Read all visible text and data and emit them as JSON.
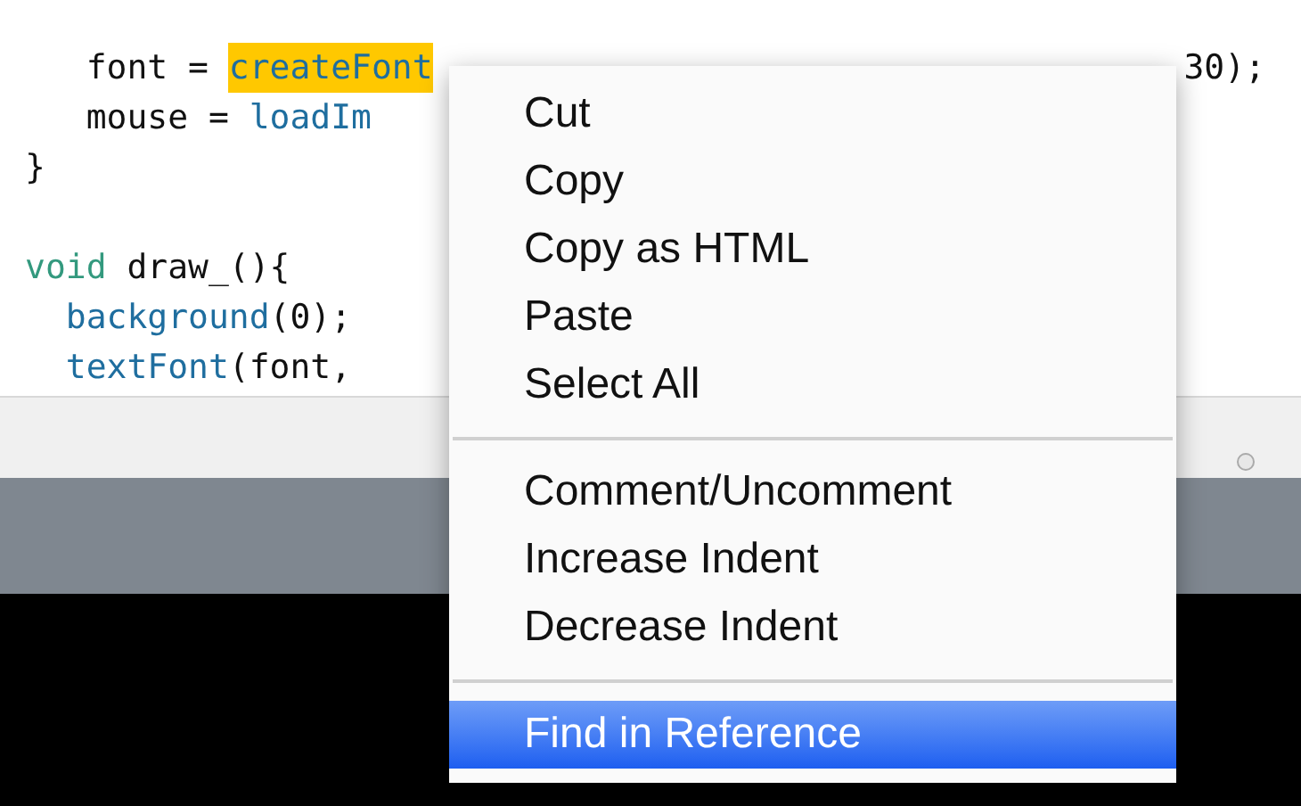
{
  "editor": {
    "lines": [
      {
        "kind": "code",
        "tokens": [
          {
            "kind": "plain",
            "text": "   font = "
          },
          {
            "kind": "selected",
            "text": "createFont"
          }
        ],
        "tail": "30);"
      },
      {
        "kind": "code",
        "tokens": [
          {
            "kind": "plain",
            "text": "   mouse = "
          },
          {
            "kind": "function",
            "text": "loadIm"
          }
        ]
      },
      {
        "kind": "code",
        "tokens": [
          {
            "kind": "plain",
            "text": "}"
          }
        ]
      },
      {
        "kind": "blank"
      },
      {
        "kind": "code",
        "tokens": [
          {
            "kind": "keyword",
            "text": "void"
          },
          {
            "kind": "plain",
            "text": " draw_(){"
          }
        ]
      },
      {
        "kind": "code",
        "tokens": [
          {
            "kind": "function",
            "text": "  background"
          },
          {
            "kind": "plain",
            "text": "(0);"
          }
        ]
      },
      {
        "kind": "code",
        "tokens": [
          {
            "kind": "function",
            "text": "  textFont"
          },
          {
            "kind": "plain",
            "text": "(font,"
          }
        ]
      }
    ]
  },
  "context_menu": {
    "groups": [
      [
        {
          "label": "Cut",
          "selected": false
        },
        {
          "label": "Copy",
          "selected": false
        },
        {
          "label": "Copy as HTML",
          "selected": false
        },
        {
          "label": "Paste",
          "selected": false
        },
        {
          "label": "Select All",
          "selected": false
        }
      ],
      [
        {
          "label": "Comment/Uncomment",
          "selected": false
        },
        {
          "label": "Increase Indent",
          "selected": false
        },
        {
          "label": "Decrease Indent",
          "selected": false
        }
      ],
      [
        {
          "label": "Find in Reference",
          "selected": true
        }
      ]
    ]
  }
}
